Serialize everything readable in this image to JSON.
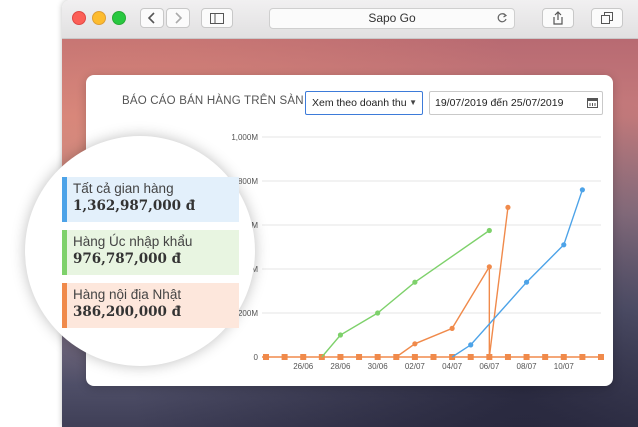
{
  "browser": {
    "url_title": "Sapo Go"
  },
  "report": {
    "title": "BÁO CÁO BÁN HÀNG TRÊN SÀN",
    "view_select": "Xem theo doanh thu",
    "date_range": "19/07/2019 đến 25/07/2019"
  },
  "legend": [
    {
      "label": "Tất cả gian hàng",
      "value": "1,362,987,000 đ",
      "color": "#4da3e8"
    },
    {
      "label": "Hàng Úc nhập khẩu",
      "value": "976,787,000 đ",
      "color": "#7ed16b"
    },
    {
      "label": "Hàng nội địa Nhật",
      "value": "386,200,000 đ",
      "color": "#f08a4b"
    }
  ],
  "chart_data": {
    "type": "line",
    "y_tick_labels": [
      "0",
      "200M",
      "400M",
      "600M",
      "800M",
      "1,000M"
    ],
    "x_tick_labels": [
      "26/06",
      "28/06",
      "30/06",
      "02/07",
      "04/07",
      "06/07",
      "08/07",
      "10/07"
    ],
    "x": [
      "24/06",
      "25/06",
      "26/06",
      "27/06",
      "28/06",
      "29/06",
      "30/06",
      "01/07",
      "02/07",
      "03/07",
      "04/07",
      "05/07",
      "06/07",
      "07/07",
      "08/07",
      "09/07",
      "10/07",
      "11/07",
      "12/07"
    ],
    "ylim": [
      0,
      1000
    ],
    "series": [
      {
        "color": "#7ed16b",
        "points": [
          [
            "27/06",
            0
          ],
          [
            "28/06",
            100
          ],
          [
            "30/06",
            200
          ],
          [
            "02/07",
            340
          ],
          [
            "06/07",
            575
          ]
        ]
      },
      {
        "color": "#f08a4b",
        "points": [
          [
            "01/07",
            0
          ],
          [
            "02/07",
            60
          ],
          [
            "04/07",
            130
          ],
          [
            "06/07",
            410
          ],
          [
            "06/07",
            0
          ],
          [
            "07/07",
            680
          ]
        ]
      },
      {
        "color": "#4da3e8",
        "points": [
          [
            "04/07",
            0
          ],
          [
            "05/07",
            55
          ],
          [
            "08/07",
            340
          ],
          [
            "10/07",
            510
          ],
          [
            "11/07",
            760
          ]
        ]
      }
    ],
    "grid": true
  }
}
